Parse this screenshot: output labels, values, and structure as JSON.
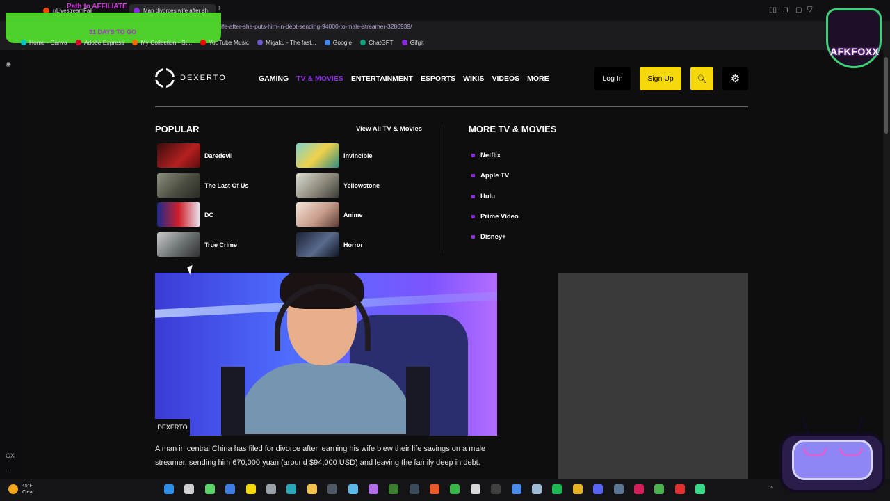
{
  "browser": {
    "tabs": [
      {
        "label": "r/LivestreamFail",
        "icon": "reddit-icon",
        "color": "#ff4500"
      },
      {
        "label": "Man divorces wife after sh",
        "icon": "dexerto-favicon",
        "color": "#8a2be2"
      }
    ],
    "url": "ife-after-she-puts-him-in-debt-sending-94000-to-male-streamer-3286939/",
    "bookmarks": [
      {
        "label": "Home - Canva",
        "color": "#00c4cc"
      },
      {
        "label": "Adobe Express",
        "color": "#e4002b"
      },
      {
        "label": "My Collection - St...",
        "color": "#ff6a00"
      },
      {
        "label": "YouTube Music",
        "color": "#ff0000"
      },
      {
        "label": "Migaku - The fast...",
        "color": "#6a5acd"
      },
      {
        "label": "Google",
        "color": "#4285f4"
      },
      {
        "label": "ChatGPT",
        "color": "#10a37f"
      },
      {
        "label": "Gifgit",
        "color": "#8a2be2"
      }
    ]
  },
  "overlay": {
    "affiliate_text": "Path to AFFILIATE",
    "days_text": "31 DAYS TO GO",
    "afk_label": "AFKFOXX"
  },
  "site": {
    "logo_text": "DEXERTO",
    "nav": [
      "GAMING",
      "TV & MOVIES",
      "ENTERTAINMENT",
      "ESPORTS",
      "WIKIS",
      "VIDEOS",
      "MORE"
    ],
    "login_label": "Log In",
    "signup_label": "Sign Up",
    "accent": "#8a2be2",
    "yellow": "#f5d90a"
  },
  "menu": {
    "popular_title": "POPULAR",
    "view_all_label": "View All TV & Movies",
    "popular_left": [
      {
        "label": "Daredevil",
        "color": "#9b1c1c"
      },
      {
        "label": "The Last Of Us",
        "color": "#5b5f4c"
      },
      {
        "label": "DC",
        "color": "#2c3f9e"
      },
      {
        "label": "True Crime",
        "color": "#6a6f72"
      }
    ],
    "popular_right": [
      {
        "label": "Invincible",
        "color": "#47b5a8"
      },
      {
        "label": "Yellowstone",
        "color": "#a1a095"
      },
      {
        "label": "Anime",
        "color": "#c79b8a"
      },
      {
        "label": "Horror",
        "color": "#36405a"
      }
    ],
    "more_title": "MORE TV & MOVIES",
    "more_items": [
      "Netflix",
      "Apple TV",
      "Hulu",
      "Prime Video",
      "Disney+"
    ]
  },
  "article": {
    "image_tag": "DEXERTO",
    "lede": "A man in central China has filed for divorce after learning his wife blew their life savings on a male streamer, sending him 670,000 yuan (around $94,000 USD) and leaving the family deep in debt."
  },
  "taskbar": {
    "temperature": "45°F",
    "condition": "Clear"
  }
}
